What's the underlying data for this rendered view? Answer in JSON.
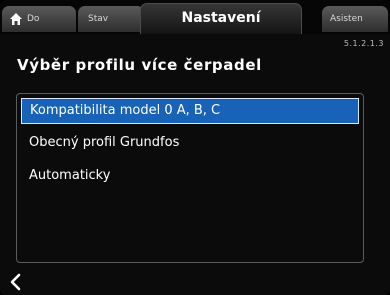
{
  "tabs": {
    "home": {
      "label": "Do",
      "icon": "home-icon"
    },
    "status": {
      "label": "Stav"
    },
    "active": {
      "label": "Nastavení"
    },
    "assist": {
      "label": "Asisten"
    }
  },
  "header": {
    "menu_id": "5.1.2.1.3",
    "title": "Výběr profilu více čerpadel"
  },
  "options": [
    {
      "label": "Kompatibilita model 0 A, B, C",
      "selected": true
    },
    {
      "label": "Obecný profil Grundfos",
      "selected": false
    },
    {
      "label": "Automaticky",
      "selected": false
    }
  ],
  "footer": {
    "back_icon": "chevron-left-icon"
  },
  "colors": {
    "selection": "#1863b8",
    "background": "#0b0b0b",
    "tab": "#4a4a4a",
    "text": "#ffffff"
  }
}
